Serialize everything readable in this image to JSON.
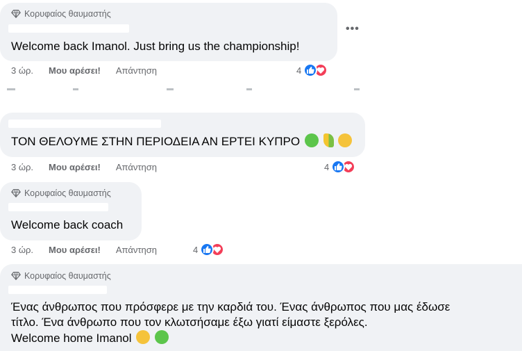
{
  "comments": [
    {
      "badge": "Κορυφαίος θαυμαστής",
      "text": "Welcome back Imanol. Just bring us the championship!",
      "time": "3 ώρ.",
      "like_label": "Μου αρέσει!",
      "reply_label": "Απάντηση",
      "reaction_count": "4"
    },
    {
      "text": "ΤΟΝ ΘΕΛΟΥΜΕ ΣΤΗΝ ΠΕΡΙΟΔΕΙΑ ΑΝ ΕΡΤΕΙ ΚΥΠΡΟ",
      "emojis": [
        "green-heart",
        "cyprus-leaf",
        "yellow-heart"
      ],
      "time": "3 ώρ.",
      "like_label": "Μου αρέσει!",
      "reply_label": "Απάντηση",
      "reaction_count": "4"
    },
    {
      "badge": "Κορυφαίος θαυμαστής",
      "text": "Welcome back coach",
      "time": "3 ώρ.",
      "like_label": "Μου αρέσει!",
      "reply_label": "Απάντηση",
      "reaction_count": "4"
    },
    {
      "badge": "Κορυφαίος θαυμαστής",
      "line1": "Ένας άνθρωπος που πρόσφερε με την καρδιά του. Ένας άνθρωπος που μας έδωσε",
      "line2": "τίτλο. Ένα άνθρωπο που τον κλωτσήσαμε έξω γιατί είμαστε ξερόλες.",
      "line3": "Welcome home Imanol",
      "emojis": [
        "yellow-heart",
        "green-heart"
      ]
    }
  ],
  "more_label": "•••",
  "colors": {
    "bubble": "#f0f2f5",
    "like_blue": "#1877f2",
    "love_red": "#f33e58",
    "meta_gray": "#65676b"
  }
}
